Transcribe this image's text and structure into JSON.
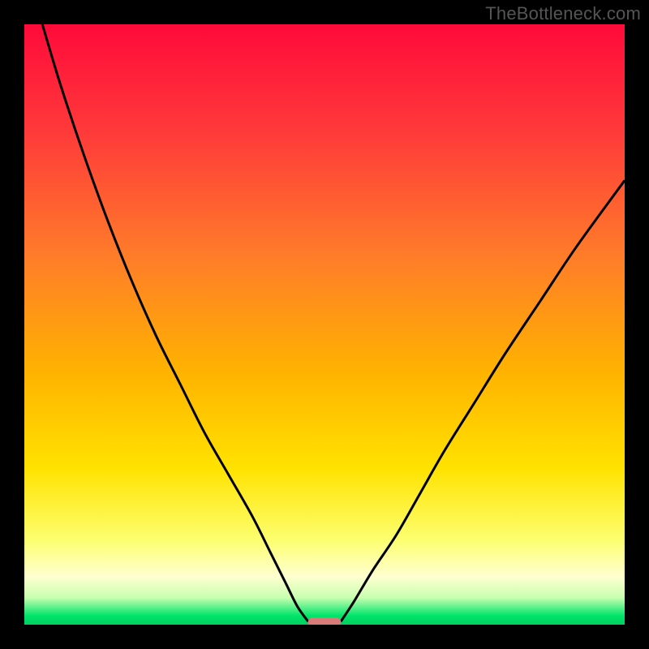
{
  "watermark": "TheBottleneck.com",
  "chart_data": {
    "type": "line",
    "title": "",
    "xlabel": "",
    "ylabel": "",
    "xlim": [
      0,
      100
    ],
    "ylim": [
      0,
      100
    ],
    "background_gradient_stops": [
      {
        "offset": 0.0,
        "color": "#ff0a3a"
      },
      {
        "offset": 0.18,
        "color": "#ff3a3a"
      },
      {
        "offset": 0.38,
        "color": "#ff7a2a"
      },
      {
        "offset": 0.58,
        "color": "#ffb300"
      },
      {
        "offset": 0.74,
        "color": "#ffe200"
      },
      {
        "offset": 0.86,
        "color": "#fcff70"
      },
      {
        "offset": 0.92,
        "color": "#ffffd0"
      },
      {
        "offset": 0.955,
        "color": "#c8ffb0"
      },
      {
        "offset": 0.985,
        "color": "#00e56a"
      },
      {
        "offset": 1.0,
        "color": "#00d060"
      }
    ],
    "series": [
      {
        "name": "left-curve",
        "x": [
          3,
          6,
          10,
          14,
          18,
          22,
          26,
          30,
          34,
          38,
          41,
          43.5,
          45.5,
          47.3
        ],
        "y": [
          100,
          90,
          78,
          67,
          57,
          48,
          40,
          32,
          25,
          18,
          12,
          7,
          3,
          0.5
        ]
      },
      {
        "name": "right-curve",
        "x": [
          52.7,
          55,
          58,
          62,
          66,
          70,
          75,
          80,
          86,
          92,
          100
        ],
        "y": [
          0.5,
          4,
          9,
          15,
          22,
          29,
          37,
          45,
          54,
          63,
          74
        ]
      }
    ],
    "marker": {
      "name": "bottleneck-marker",
      "x_center": 50,
      "width": 5.5,
      "y": 0.4,
      "color": "#d97a7a"
    }
  }
}
